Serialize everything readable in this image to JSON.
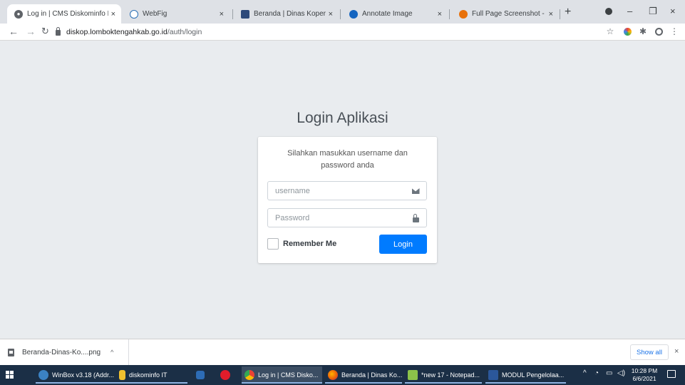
{
  "browser": {
    "tabs": [
      {
        "title": "Log in | CMS Diskominfo Kab",
        "close": "×"
      },
      {
        "title": "WebFig",
        "close": "×"
      },
      {
        "title": "Beranda | Dinas Koperasi dan",
        "close": "×"
      },
      {
        "title": "Annotate Image",
        "close": "×"
      },
      {
        "title": "Full Page Screenshot - Chrom",
        "close": "×"
      }
    ],
    "new_tab": "+",
    "url_host": "diskop.lomboktengahkab.go.id",
    "url_path": "/auth/login",
    "window_controls": {
      "minimize": "–",
      "restore": "❐",
      "close": "×"
    }
  },
  "login": {
    "title": "Login Aplikasi",
    "message": "Silahkan masukkan username dan password anda",
    "username_placeholder": "username",
    "password_placeholder": "Password",
    "remember_label": "Remember Me",
    "submit_label": "Login",
    "colors": {
      "primary": "#007bff",
      "background": "#e9ecef"
    }
  },
  "downloads": {
    "item_name": "Beranda-Dinas-Ko....png",
    "caret": "^",
    "show_all": "Show all",
    "close": "×"
  },
  "taskbar": {
    "apps": [
      {
        "label": "WinBox v3.18 (Addr...",
        "icon": "winbox-icon"
      },
      {
        "label": "diskominfo IT",
        "icon": "folder-icon"
      },
      {
        "label": "",
        "icon": "media-icon"
      },
      {
        "label": "",
        "icon": "opera-icon"
      },
      {
        "label": "Log in | CMS Disko...",
        "icon": "chrome-icon"
      },
      {
        "label": "Beranda | Dinas Ko...",
        "icon": "firefox-icon"
      },
      {
        "label": "*new 17 - Notepad...",
        "icon": "notepad-icon"
      },
      {
        "label": "MODUL Pengelolaa...",
        "icon": "word-icon"
      }
    ],
    "time": "10:28 PM",
    "date": "6/6/2021"
  }
}
